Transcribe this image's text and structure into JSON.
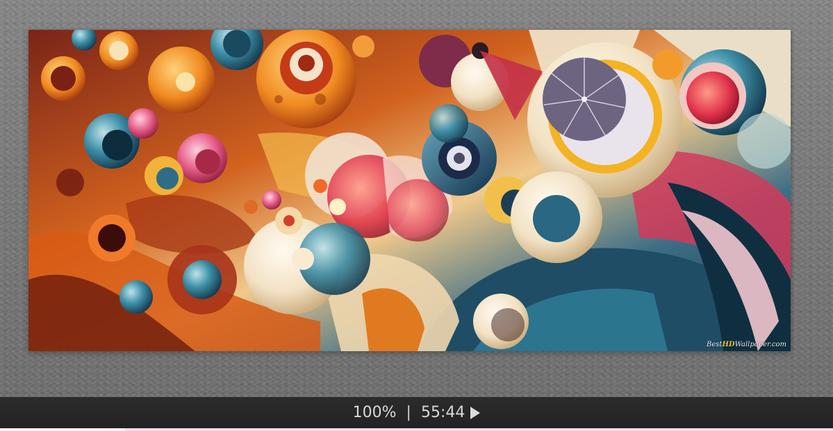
{
  "viewer": {
    "image_alt": "Abstract colorful circles wallpaper",
    "watermark": {
      "prefix": "Best",
      "hd": "HD",
      "suffix": "Wallpaper.com"
    }
  },
  "status_bar": {
    "zoom": "100%",
    "separator": "|",
    "time": "55:44"
  },
  "colors": {
    "status_bar_bg": "#242424",
    "viewer_bg": "#7b7b7b",
    "status_text": "#d9d9d9"
  },
  "icons": {
    "play": "play-icon"
  }
}
